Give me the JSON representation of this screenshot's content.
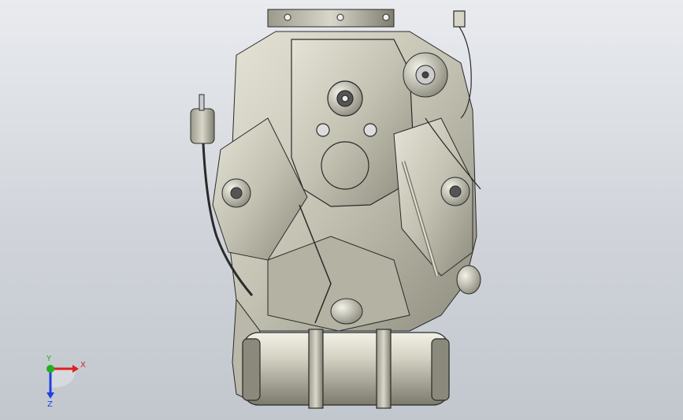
{
  "viewport": {
    "model": "engine-assembly",
    "view_orientation": "front",
    "background_top": "#e9ebef",
    "background_bottom": "#c2c7ce"
  },
  "triad": {
    "x_label": "X",
    "y_label": "Y",
    "z_label": "Z",
    "x_color": "#e02020",
    "y_color": "#20b020",
    "z_color": "#2040e0"
  },
  "colors": {
    "metal": "#c9c8b8",
    "metal_dark": "#8f8e80",
    "line": "#2a2a2a"
  }
}
